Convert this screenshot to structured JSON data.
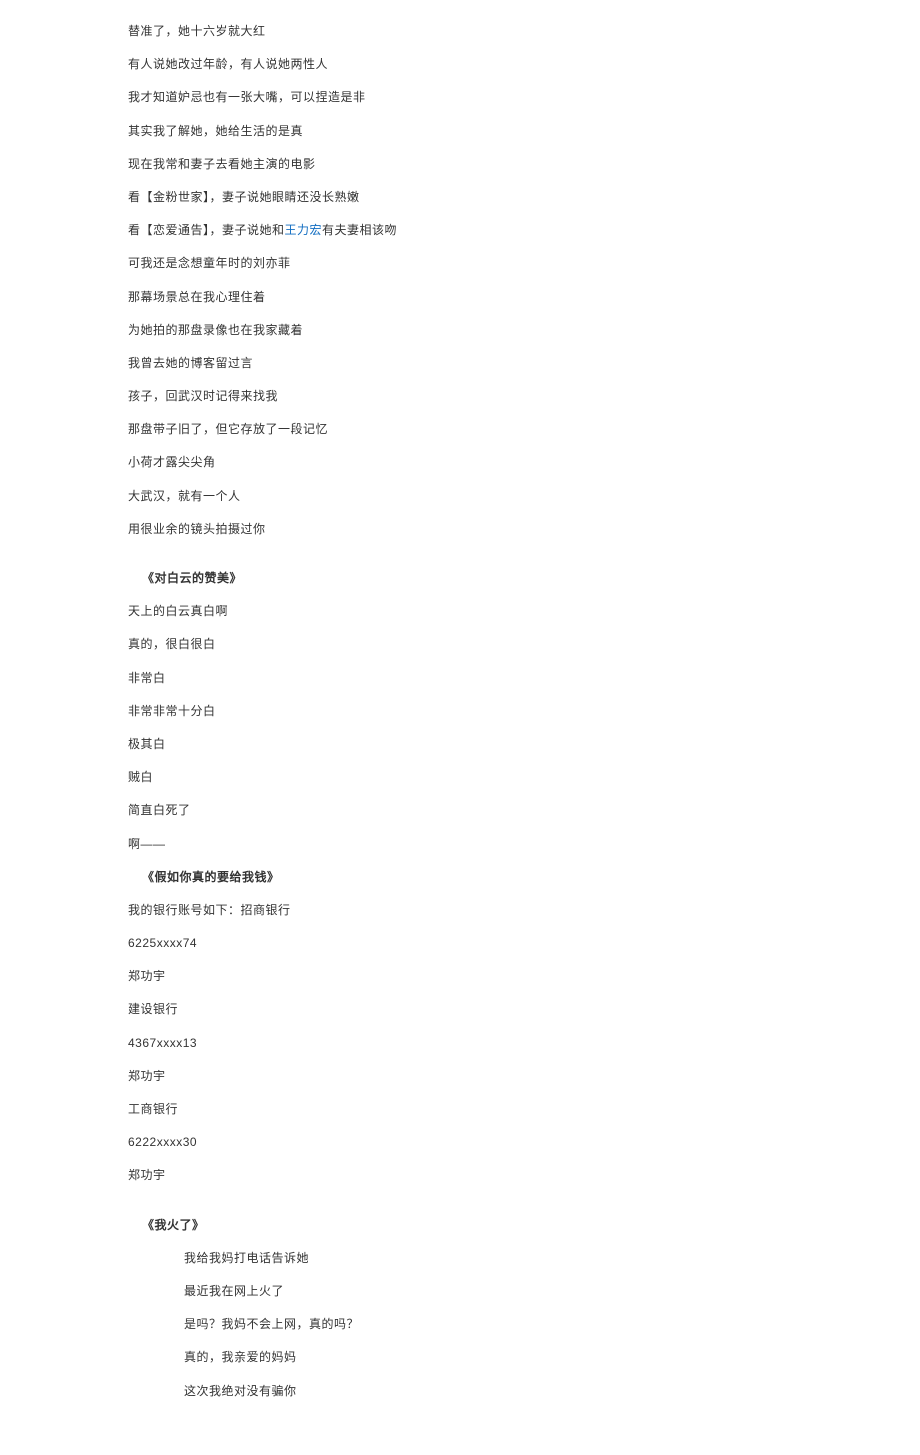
{
  "section1": {
    "lines": [
      "替准了，她十六岁就大红",
      "有人说她改过年龄，有人说她两性人",
      "我才知道妒忌也有一张大嘴，可以捏造是非",
      "其实我了解她，她给生活的是真",
      "现在我常和妻子去看她主演的电影",
      "看【金粉世家】，妻子说她眼睛还没长熟嫩"
    ],
    "line_link": {
      "prefix": "看【恋爱通告】，妻子说她和",
      "link_text": "王力宏",
      "suffix": "有夫妻相该吻"
    },
    "lines_after": [
      "可我还是念想童年时的刘亦菲",
      "那幕场景总在我心理住着",
      "为她拍的那盘录像也在我家藏着",
      "我曾去她的博客留过言",
      "孩子，回武汉时记得来找我",
      "那盘带子旧了，但它存放了一段记忆",
      "小荷才露尖尖角",
      "大武汉，就有一个人",
      "用很业余的镜头拍摄过你"
    ]
  },
  "section2": {
    "title": "《对白云的赞美》",
    "lines": [
      "天上的白云真白啊",
      "真的，很白很白",
      "非常白",
      "非常非常十分白",
      "极其白",
      "贼白",
      "简直白死了",
      "啊——"
    ]
  },
  "section3": {
    "title": "《假如你真的要给我钱》",
    "lines": [
      "我的银行账号如下：招商银行",
      "6225xxxx74",
      "郑功宇",
      "建设银行",
      "4367xxxx13",
      "郑功宇",
      "工商银行",
      "6222xxxx30",
      "郑功宇"
    ]
  },
  "section4": {
    "title": "《我火了》",
    "lines": [
      "我给我妈打电话告诉她",
      "最近我在网上火了",
      "是吗？我妈不会上网，真的吗？",
      "真的，我亲爱的妈妈",
      "这次我绝对没有骗你"
    ]
  }
}
